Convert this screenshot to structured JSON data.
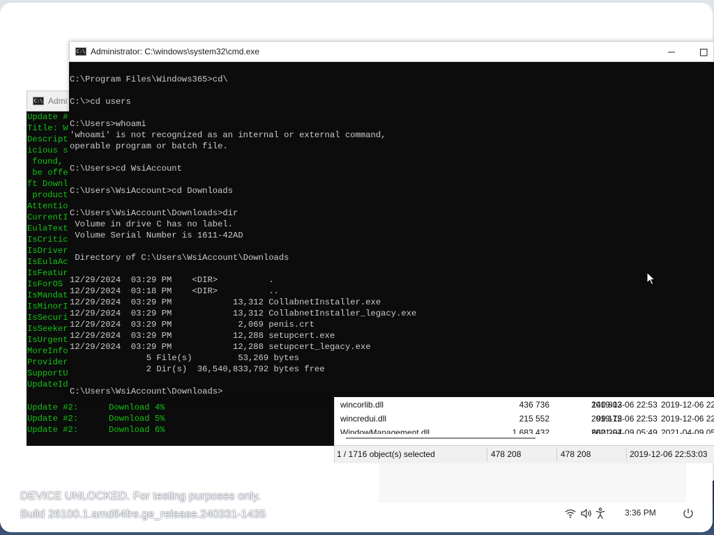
{
  "front_window": {
    "title": "Administrator: C:\\windows\\system32\\cmd.exe",
    "minimize_glyph": "—",
    "maximize_glyph": "☐",
    "lines": [
      "C:\\Program Files\\Windows365>cd\\",
      "",
      "C:\\>cd users",
      "",
      "C:\\Users>whoami",
      "'whoami' is not recognized as an internal or external command,",
      "operable program or batch file.",
      "",
      "C:\\Users>cd WsiAccount",
      "",
      "C:\\Users\\WsiAccount>cd Downloads",
      "",
      "C:\\Users\\WsiAccount\\Downloads>dir",
      " Volume in drive C has no label.",
      " Volume Serial Number is 1611-42AD",
      "",
      " Directory of C:\\Users\\WsiAccount\\Downloads",
      "",
      "12/29/2024  03:29 PM    <DIR>          .",
      "12/29/2024  03:18 PM    <DIR>          ..",
      "12/29/2024  03:29 PM            13,312 CollabnetInstaller.exe",
      "12/29/2024  03:29 PM            13,312 CollabnetInstaller_legacy.exe",
      "12/29/2024  03:29 PM             2,069 penis.crt",
      "12/29/2024  03:29 PM            12,288 setupcert.exe",
      "12/29/2024  03:29 PM            12,288 setupcert_legacy.exe",
      "               5 File(s)         53,269 bytes",
      "               2 Dir(s)  36,540,833,792 bytes free",
      "",
      "C:\\Users\\WsiAccount\\Downloads>"
    ]
  },
  "back_window": {
    "title": "Admi",
    "lines": [
      "Update #",
      "Title: W",
      "Descript",
      "icious s",
      " found, ",
      " be offe",
      "ft Downl",
      " product",
      "Attentio",
      "CurrentI",
      "EulaText",
      "IsCritic",
      "IsDriver",
      "IsEulaAc",
      "IsFeatur",
      "IsForOS",
      "IsMandat",
      "IsMinorI",
      "IsSecuri",
      "IsSeeker",
      "IsUrgent",
      "MoreInfo",
      "Provider",
      "SupportU",
      "UpdateId"
    ],
    "progress_lines": [
      "Update #2:      Download 4%",
      "Update #2:      Download 5%",
      "Update #2:      Download 6%"
    ]
  },
  "file_list": {
    "rows": [
      {
        "name": "wincorlib.dll",
        "size": "436 736",
        "packed": "140 803",
        "modified": "2019-12-06 22:53",
        "created": "2019-12-06 22:"
      },
      {
        "name": "wincredui.dll",
        "size": "215 552",
        "packed": "99 175",
        "modified": "2019-12-06 22:53",
        "created": "2019-12-06 22:"
      },
      {
        "name": "WindowManagement.dll",
        "size": "1 683 432",
        "packed": "660 297",
        "modified": "2021-04-09 05:49",
        "created": "2021-04-09 05:"
      }
    ],
    "status": {
      "selection": "1 / 1716 object(s) selected",
      "size": "478 208",
      "packed": "478 208",
      "modified": "2019-12-06 22:53:03"
    }
  },
  "watermark": {
    "line1": "DEVICE UNLOCKED. For testing purposes only.",
    "line2": "Build 26100.1.amd64fre.ge_release.240331-1435"
  },
  "tray": {
    "time": "3:36 PM",
    "icons": [
      "wifi-icon",
      "volume-icon",
      "accessibility-icon",
      "power-icon"
    ]
  },
  "colors": {
    "console_bg": "#0c0c0c",
    "console_text": "#cccccc",
    "green_text": "#13c313"
  }
}
